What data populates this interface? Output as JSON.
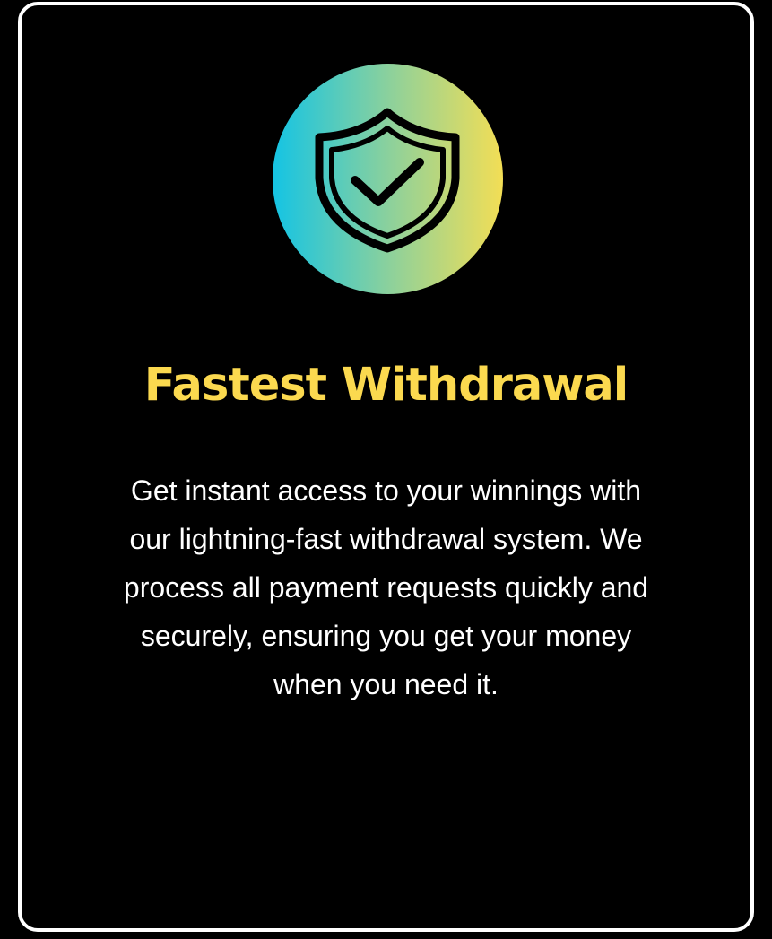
{
  "feature": {
    "icon": "shield-check-icon",
    "title": "Fastest Withdrawal",
    "description": "Get instant access to your winnings with our lightning-fast withdrawal system. We process all payment requests quickly and securely, ensuring you get your money when you need it."
  },
  "colors": {
    "background": "#000000",
    "card_border": "#ffffff",
    "title": "#fbd94f",
    "description": "#ffffff",
    "icon_gradient_start": "#14c4e4",
    "icon_gradient_end": "#f3de55",
    "icon_stroke": "#000000"
  }
}
